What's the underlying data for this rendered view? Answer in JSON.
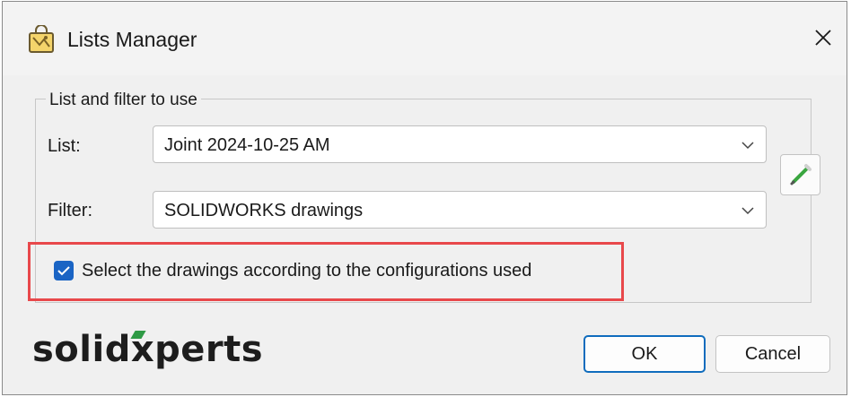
{
  "window": {
    "title": "Lists Manager",
    "icon": "lists-manager-icon",
    "close_icon": "close-icon"
  },
  "group": {
    "legend": "List and filter to use",
    "list_label": "List:",
    "list_value": "Joint 2024-10-25 AM",
    "filter_label": "Filter:",
    "filter_value": "SOLIDWORKS drawings",
    "edit_icon": "pencil-icon",
    "checkbox_label": "Select the drawings according to the configurations used",
    "checkbox_checked": true,
    "highlight_color": "#e8484b"
  },
  "footer": {
    "logo_prefix": "solid",
    "logo_x": "x",
    "logo_suffix": "perts",
    "logo_accent_color": "#2e9a45",
    "ok_label": "OK",
    "cancel_label": "Cancel"
  },
  "colors": {
    "accent": "#0f6cbd",
    "checkbox": "#1a64c4"
  }
}
